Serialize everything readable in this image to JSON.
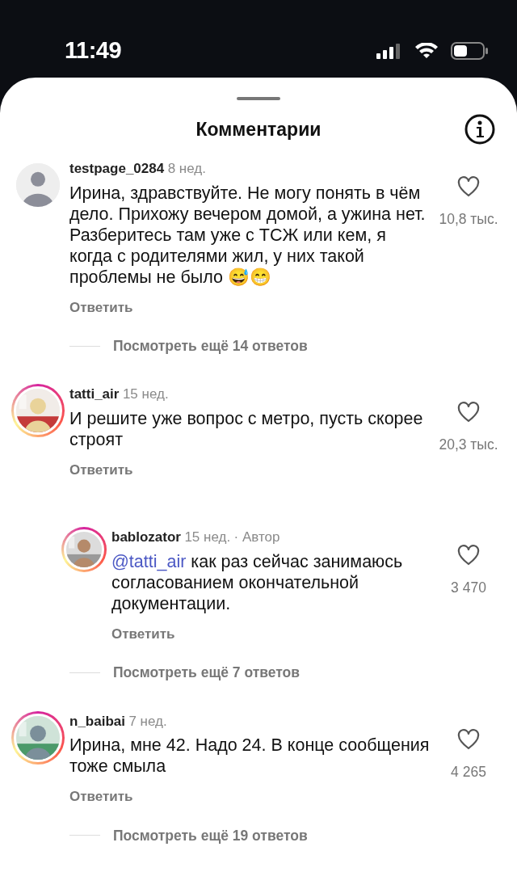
{
  "status_bar": {
    "time": "11:49"
  },
  "sheet": {
    "title": "Комментарии"
  },
  "comments": [
    {
      "username": "testpage_0284",
      "time": "8 нед.",
      "avatar": {
        "kind": "placeholder"
      },
      "story_ring": false,
      "text": "Ирина, здравствуйте. Не могу понять в чём дело. Прихожу вечером домой, а ужина нет. Разберитесь там уже с ТСЖ или кем, я когда с родителями жил, у них такой проблемы не было 😅😁",
      "likes": "10,8 тыс.",
      "reply_label": "Ответить",
      "view_more": "Посмотреть ещё 14 ответов"
    },
    {
      "username": "tatti_air",
      "time": "15 нед.",
      "story_ring": true,
      "text": "И решите уже вопрос с метро, пусть скорее строят",
      "likes": "20,3 тыс.",
      "reply_label": "Ответить",
      "replies": [
        {
          "username": "bablozator",
          "time": "15 нед.",
          "author_badge": "· Автор",
          "story_ring": true,
          "mention": "@tatti_air",
          "text": "как раз сейчас занимаюсь согласованием окончательной документации.",
          "likes": "3 470",
          "reply_label": "Ответить"
        }
      ],
      "view_more": "Посмотреть ещё 7 ответов"
    },
    {
      "username": "n_baibai",
      "time": "7 нед.",
      "story_ring": true,
      "text": "Ирина, мне 42. Надо 24. В конце сообщения тоже смыла",
      "likes": "4 265",
      "reply_label": "Ответить",
      "view_more": "Посмотреть ещё 19 ответов"
    }
  ]
}
